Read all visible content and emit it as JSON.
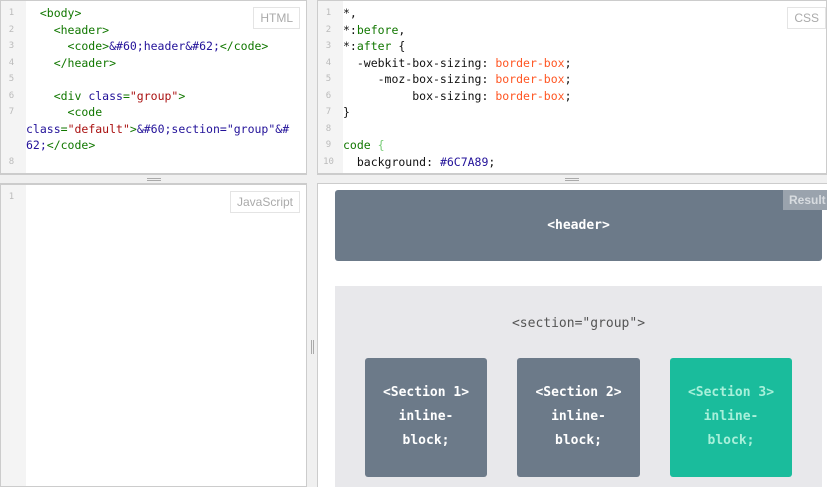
{
  "html_panel": {
    "label": "HTML",
    "lines": [
      {
        "n": "1",
        "parts": [
          [
            "tag",
            "  <body>"
          ]
        ]
      },
      {
        "n": "2",
        "parts": [
          [
            "tag",
            "    <header>"
          ]
        ]
      },
      {
        "n": "3",
        "parts": [
          [
            "tag",
            "      <code>"
          ],
          [
            "attr",
            "&#60;header&#62;"
          ],
          [
            "tag",
            "</code>"
          ]
        ]
      },
      {
        "n": "4",
        "parts": [
          [
            "tag",
            "    </header>"
          ]
        ]
      },
      {
        "n": "5",
        "parts": []
      },
      {
        "n": "6",
        "parts": [
          [
            "tag",
            "    <div "
          ],
          [
            "attr",
            "class"
          ],
          [
            "tag",
            "="
          ],
          [
            "str",
            "\"group\""
          ],
          [
            "tag",
            ">"
          ]
        ]
      },
      {
        "n": "7",
        "parts": [
          [
            "tag",
            "      <code"
          ]
        ]
      },
      {
        "n": "",
        "parts": [
          [
            "attr",
            "class"
          ],
          [
            "tag",
            "="
          ],
          [
            "str",
            "\"default\""
          ],
          [
            "tag",
            ">"
          ],
          [
            "attr",
            "&#60;section=\"group\"&#"
          ]
        ]
      },
      {
        "n": "",
        "parts": [
          [
            "attr",
            "62;"
          ],
          [
            "tag",
            "</code>"
          ]
        ]
      },
      {
        "n": "8",
        "parts": []
      }
    ]
  },
  "css_panel": {
    "label": "CSS",
    "lines": [
      {
        "n": "1",
        "parts": [
          [
            "code",
            "*,"
          ]
        ]
      },
      {
        "n": "2",
        "parts": [
          [
            "code",
            "*:"
          ],
          [
            "pse",
            "before"
          ],
          [
            "code",
            ","
          ]
        ]
      },
      {
        "n": "3",
        "parts": [
          [
            "code",
            "*:"
          ],
          [
            "pse",
            "after"
          ],
          [
            "code",
            " {"
          ]
        ]
      },
      {
        "n": "4",
        "parts": [
          [
            "code",
            "  -webkit-box-sizing: "
          ],
          [
            "val",
            "border-box"
          ],
          [
            "code",
            ";"
          ]
        ]
      },
      {
        "n": "5",
        "parts": [
          [
            "code",
            "     -moz-box-sizing: "
          ],
          [
            "val",
            "border-box"
          ],
          [
            "code",
            ";"
          ]
        ]
      },
      {
        "n": "6",
        "parts": [
          [
            "code",
            "          box-sizing: "
          ],
          [
            "val",
            "border-box"
          ],
          [
            "code",
            ";"
          ]
        ]
      },
      {
        "n": "7",
        "parts": [
          [
            "code",
            "}"
          ]
        ]
      },
      {
        "n": "8",
        "parts": []
      },
      {
        "n": "9",
        "parts": [
          [
            "tag",
            "code "
          ],
          [
            "br",
            "{"
          ]
        ]
      },
      {
        "n": "10",
        "parts": [
          [
            "code",
            "  background: "
          ],
          [
            "hex",
            "#6C7A89"
          ],
          [
            "code",
            ";"
          ]
        ]
      }
    ]
  },
  "js_panel": {
    "label": "JavaScript",
    "lines": [
      {
        "n": "1",
        "parts": []
      }
    ]
  },
  "result": {
    "label": "Result",
    "header": "<header>",
    "group_title": "<section=\"group\">",
    "sections": [
      {
        "title": "<Section 1>",
        "l2": "inline-",
        "l3": "block;"
      },
      {
        "title": "<Section 2>",
        "l2": "inline-",
        "l3": "block;"
      },
      {
        "title": "<Section 3>",
        "l2": "inline-",
        "l3": "block;"
      }
    ]
  },
  "colors": {
    "box": "#6C7A89",
    "accent": "#1ABC9C"
  }
}
